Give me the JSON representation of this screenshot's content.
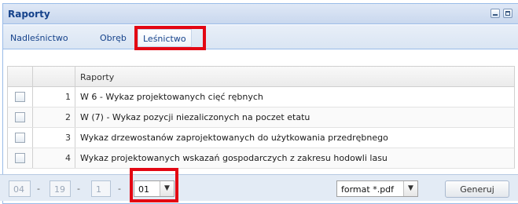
{
  "panel": {
    "title": "Raporty"
  },
  "tabs": [
    {
      "label": "Nadleśnictwo",
      "active": false
    },
    {
      "label": "Obręb",
      "active": false
    },
    {
      "label": "Leśnictwo",
      "active": true
    }
  ],
  "grid": {
    "column_header": "Raporty",
    "rows": [
      {
        "num": "1",
        "text": "W 6 - Wykaz projektowanych cięć rębnych",
        "checked": false
      },
      {
        "num": "2",
        "text": "W (7) - Wykaz pozycji niezaliczonych na poczet etatu",
        "checked": false
      },
      {
        "num": "3",
        "text": "Wykaz drzewostanów zaprojektowanych do użytkowania przedrębnego",
        "checked": false
      },
      {
        "num": "4",
        "text": "Wykaz projektowanych wskazań gospodarczych z zakresu hodowli lasu",
        "checked": false
      }
    ]
  },
  "footer": {
    "code_parts": [
      "04",
      "19",
      "1"
    ],
    "separator": "-",
    "selected_code": "01",
    "format": "format *.pdf",
    "generate_label": "Generuj"
  },
  "colors": {
    "highlight": "#e30613",
    "header_text": "#15428b"
  },
  "icons": {
    "minimize": "minimize-icon",
    "maximize": "maximize-icon",
    "dropdown": "chevron-down-icon"
  }
}
